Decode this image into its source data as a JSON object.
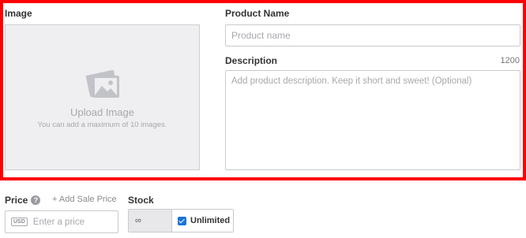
{
  "image_section": {
    "label": "Image",
    "upload_title": "Upload Image",
    "upload_subtitle": "You can add a maximum of 10 images.",
    "upload_icon": "image-icon"
  },
  "product_name": {
    "label": "Product Name",
    "placeholder": "Product name",
    "value": ""
  },
  "description": {
    "label": "Description",
    "char_limit": "1200",
    "placeholder": "Add product description. Keep it short and sweet! (Optional)",
    "value": ""
  },
  "price": {
    "label": "Price",
    "help_icon": "?",
    "add_sale_label": "+ Add Sale Price",
    "currency": "USD",
    "placeholder": "Enter a price"
  },
  "stock": {
    "label": "Stock",
    "value": "∞",
    "unlimited_label": "Unlimited",
    "unlimited_checked": true
  },
  "colors": {
    "highlight": "#ff0000",
    "accent": "#1a73d9",
    "muted_text": "#a7a8ad"
  }
}
